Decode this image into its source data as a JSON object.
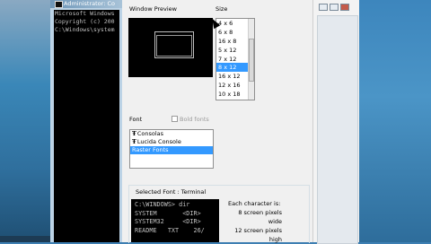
{
  "console": {
    "title": "Administrator: Co",
    "lines": [
      "Microsoft Windows",
      "Copyright (c) 200",
      "",
      "C:\\Windows\\system"
    ]
  },
  "dialog": {
    "window_preview_label": "Window Preview",
    "size_label": "Size",
    "sizes": [
      "4 x 6",
      "6 x 8",
      "16 x 8",
      "5 x 12",
      "7 x 12",
      "8 x 12",
      "16 x 12",
      "12 x 16",
      "10 x 18"
    ],
    "selected_size": "8 x 12",
    "font_label": "Font",
    "bold_fonts_label": "Bold fonts",
    "fonts": [
      {
        "icon": "Ŧ",
        "name": "Consolas"
      },
      {
        "icon": "Ŧ",
        "name": "Lucida Console"
      },
      {
        "icon": "",
        "name": "Raster Fonts"
      }
    ],
    "selected_font": "Raster Fonts",
    "selected_font_label": "Selected Font : Terminal",
    "preview_lines": [
      "C:\\WINDOWS> dir",
      "SYSTEM       <DIR>",
      "SYSTEM32     <DIR>",
      "README   TXT    26/"
    ],
    "char_desc": [
      "Each character is:",
      "8 screen pixels wide",
      "12 screen pixels high"
    ]
  },
  "colors": {
    "selection": "#3399ff",
    "console_bg": "#000000"
  }
}
